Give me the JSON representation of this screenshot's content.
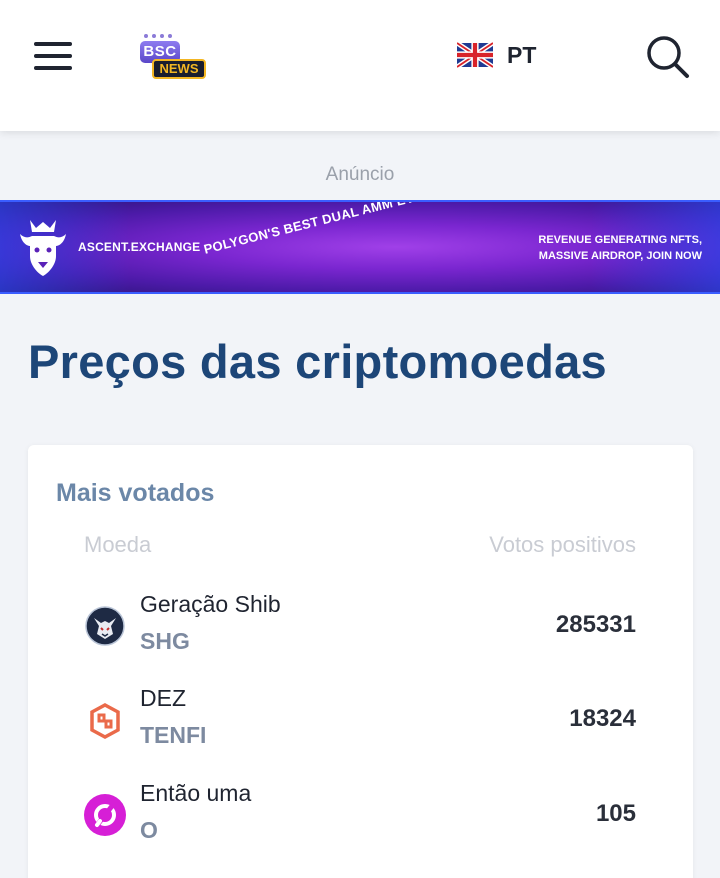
{
  "header": {
    "logo_top": "BSC",
    "logo_bottom": "NEWS",
    "language_code": "PT",
    "language_flag": "uk-flag-icon",
    "menu_icon": "hamburger-menu-icon",
    "search_icon": "search-icon"
  },
  "ad": {
    "label": "Anúncio",
    "banner": {
      "brand": "ASCENT.EXCHANGE",
      "tagline": "POLYGON'S BEST DUAL AMM EVER",
      "promo_line1": "REVENUE GENERATING NFTS,",
      "promo_line2": "MASSIVE AIRDROP, JOIN NOW",
      "colors": {
        "primary": "#7a26d0",
        "edge": "#3a5dff"
      }
    }
  },
  "page": {
    "title": "Preços das criptomoedas"
  },
  "top_voted": {
    "title": "Mais votados",
    "columns": {
      "coin": "Moeda",
      "votes": "Votos positivos"
    },
    "rows": [
      {
        "name": "Geração Shib",
        "symbol": "SHG",
        "votes": "285331",
        "icon": "shib-wolf-icon"
      },
      {
        "name": "DEZ",
        "symbol": "TENFI",
        "votes": "18324",
        "icon": "tenfi-hexagon-icon"
      },
      {
        "name": "Então uma",
        "symbol": "O",
        "votes": "105",
        "icon": "o-coin-icon"
      }
    ]
  },
  "colors": {
    "title": "#1d4678",
    "card_title": "#6b87a8",
    "symbol": "#7d8aa0",
    "background": "#f2f4f8"
  }
}
